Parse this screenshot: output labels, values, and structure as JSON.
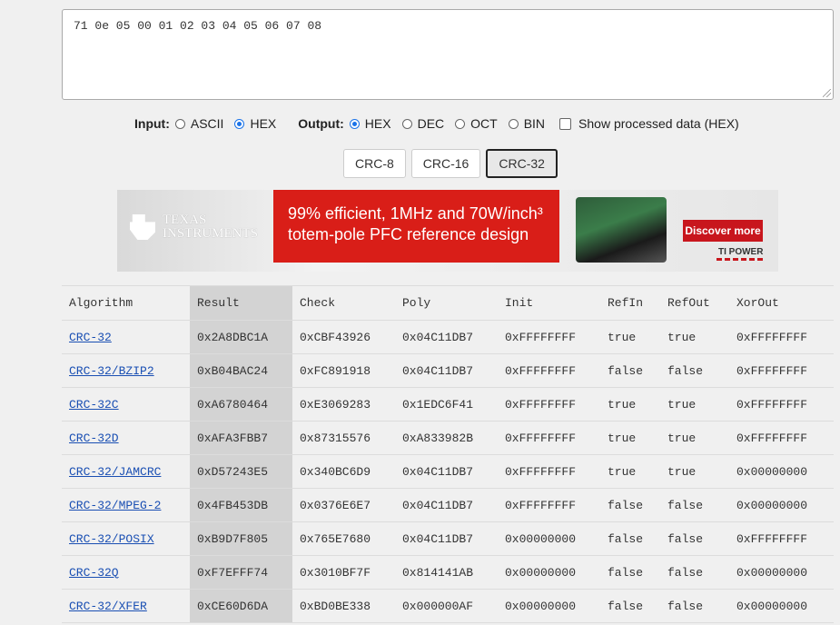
{
  "input_text": "71 0e 05 00 01 02 03 04 05 06 07 08",
  "input_group": {
    "label": "Input:",
    "options": [
      {
        "label": "ASCII",
        "checked": false
      },
      {
        "label": "HEX",
        "checked": true
      }
    ]
  },
  "output_group": {
    "label": "Output:",
    "options": [
      {
        "label": "HEX",
        "checked": true
      },
      {
        "label": "DEC",
        "checked": false
      },
      {
        "label": "OCT",
        "checked": false
      },
      {
        "label": "BIN",
        "checked": false
      }
    ]
  },
  "show_processed_label": "Show processed data (HEX)",
  "crc_buttons": [
    "CRC-8",
    "CRC-16",
    "CRC-32"
  ],
  "active_crc": "CRC-32",
  "ad": {
    "logo_line1": "TEXAS",
    "logo_line2": "INSTRUMENTS",
    "headline_line1": "99% efficient, 1MHz and 70W/inch³",
    "headline_line2": "totem-pole PFC reference design",
    "cta": "Discover more",
    "brand": "TI POWER"
  },
  "table": {
    "headers": [
      "Algorithm",
      "Result",
      "Check",
      "Poly",
      "Init",
      "RefIn",
      "RefOut",
      "XorOut"
    ],
    "rows": [
      [
        "CRC-32",
        "0x2A8DBC1A",
        "0xCBF43926",
        "0x04C11DB7",
        "0xFFFFFFFF",
        "true",
        "true",
        "0xFFFFFFFF"
      ],
      [
        "CRC-32/BZIP2",
        "0xB04BAC24",
        "0xFC891918",
        "0x04C11DB7",
        "0xFFFFFFFF",
        "false",
        "false",
        "0xFFFFFFFF"
      ],
      [
        "CRC-32C",
        "0xA6780464",
        "0xE3069283",
        "0x1EDC6F41",
        "0xFFFFFFFF",
        "true",
        "true",
        "0xFFFFFFFF"
      ],
      [
        "CRC-32D",
        "0xAFA3FBB7",
        "0x87315576",
        "0xA833982B",
        "0xFFFFFFFF",
        "true",
        "true",
        "0xFFFFFFFF"
      ],
      [
        "CRC-32/JAMCRC",
        "0xD57243E5",
        "0x340BC6D9",
        "0x04C11DB7",
        "0xFFFFFFFF",
        "true",
        "true",
        "0x00000000"
      ],
      [
        "CRC-32/MPEG-2",
        "0x4FB453DB",
        "0x0376E6E7",
        "0x04C11DB7",
        "0xFFFFFFFF",
        "false",
        "false",
        "0x00000000"
      ],
      [
        "CRC-32/POSIX",
        "0xB9D7F805",
        "0x765E7680",
        "0x04C11DB7",
        "0x00000000",
        "false",
        "false",
        "0xFFFFFFFF"
      ],
      [
        "CRC-32Q",
        "0xF7EFFF74",
        "0x3010BF7F",
        "0x814141AB",
        "0x00000000",
        "false",
        "false",
        "0x00000000"
      ],
      [
        "CRC-32/XFER",
        "0xCE60D6DA",
        "0xBD0BE338",
        "0x000000AF",
        "0x00000000",
        "false",
        "false",
        "0x00000000"
      ]
    ]
  }
}
